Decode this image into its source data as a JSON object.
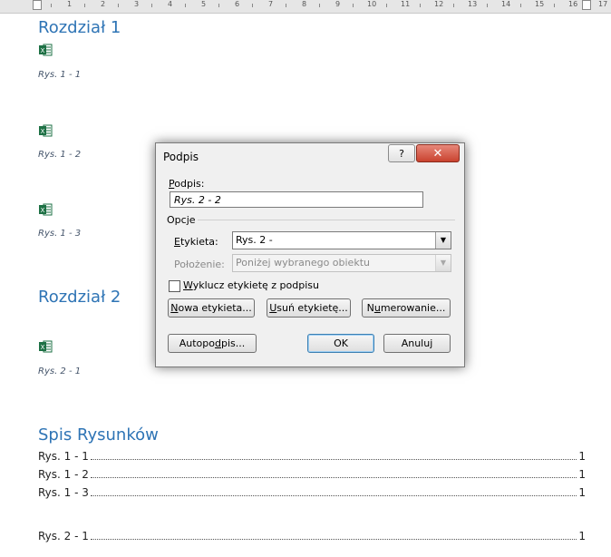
{
  "ruler": {
    "numbers": [
      "1",
      "2",
      "3",
      "4",
      "5",
      "6",
      "7",
      "8",
      "9",
      "10",
      "11",
      "12",
      "13",
      "14",
      "15",
      "16",
      "17"
    ]
  },
  "document": {
    "chapter1_title": "Rozdział 1",
    "chapter2_title": "Rozdział 2",
    "toc_title": "Spis Rysunków",
    "captions": [
      "Rys. 1 - 1",
      "Rys. 1 - 2",
      "Rys. 1 - 3",
      "Rys. 2 - 1"
    ],
    "toc": [
      {
        "label": "Rys. 1 - 1",
        "page": "1"
      },
      {
        "label": "Rys. 1 - 2",
        "page": "1"
      },
      {
        "label": "Rys. 1 - 3",
        "page": "1"
      },
      {
        "label": "Rys. 2 - 1",
        "page": "1"
      }
    ],
    "icons": [
      "excel-icon"
    ]
  },
  "dialog": {
    "title": "Podpis",
    "help_label": "?",
    "close_label": "✕",
    "caption_label": "Podpis:",
    "caption_value": "Rys. 2 - 2",
    "options_label": "Opcje",
    "label_label": "Etykieta:",
    "label_value": "Rys. 2 -",
    "position_label": "Położenie:",
    "position_value": "Poniżej wybranego obiektu",
    "exclude_label": "Wyklucz etykietę z podpisu",
    "exclude_checked": false,
    "new_label_button": "Nowa etykieta...",
    "delete_label_button": "Usuń etykietę...",
    "numbering_button": "Numerowanie...",
    "autocaption_button": "Autopodpis...",
    "ok_button": "OK",
    "cancel_button": "Anuluj"
  },
  "colors": {
    "heading": "#2e74b5",
    "caption": "#44546a",
    "excel_green": "#1e7145",
    "close_red": "#c9422f"
  }
}
